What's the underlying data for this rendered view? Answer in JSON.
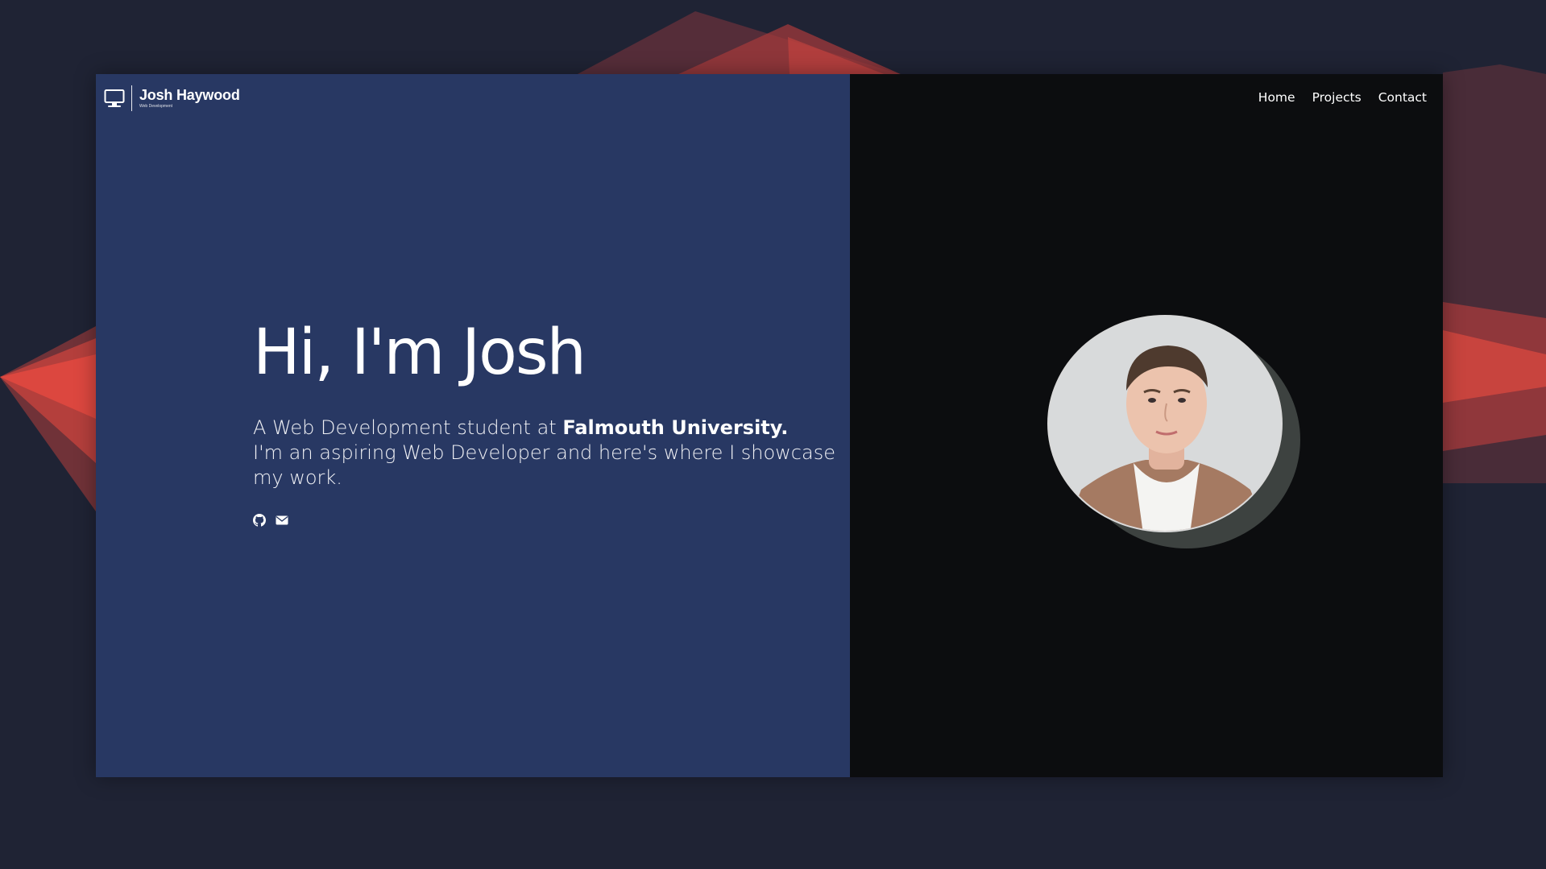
{
  "brand": {
    "name": "Josh Haywood",
    "tagline": "Web Development",
    "icon": "monitor-icon"
  },
  "nav": {
    "items": [
      {
        "label": "Home"
      },
      {
        "label": "Projects"
      },
      {
        "label": "Contact"
      }
    ]
  },
  "hero": {
    "title": "Hi, I'm Josh",
    "line1_prefix": "A Web Development student at ",
    "line1_emphasis": "Falmouth University.",
    "line2": "I'm an aspiring Web Developer and here's where I showcase my work."
  },
  "socials": [
    {
      "icon": "github-icon"
    },
    {
      "icon": "email-icon"
    }
  ],
  "colors": {
    "page_background": "#1f2334",
    "left_pane": "#283863",
    "right_pane": "#0c0d0f",
    "accent_red": "#e0483f",
    "text": "#ffffff"
  }
}
